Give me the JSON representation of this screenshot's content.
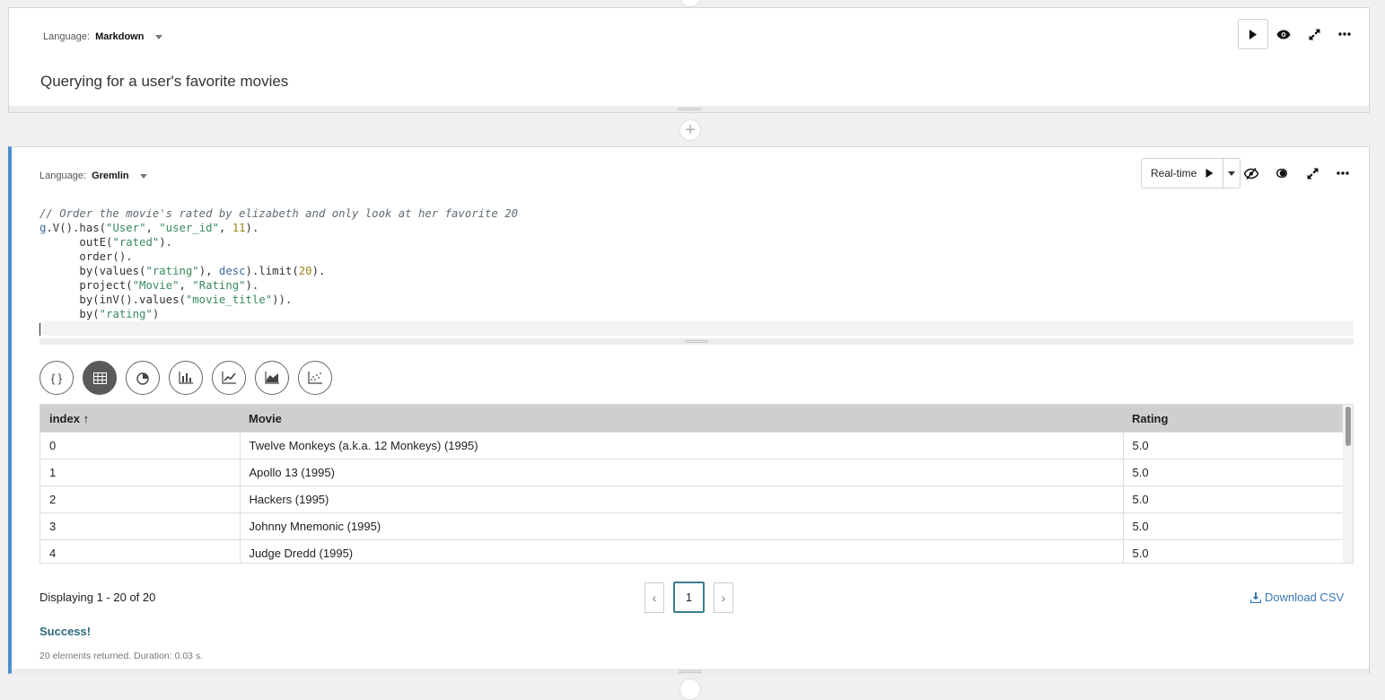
{
  "markdown_cell": {
    "language_label": "Language:",
    "language_value": "Markdown",
    "content": "Querying for a user's favorite movies"
  },
  "gremlin_cell": {
    "language_label": "Language:",
    "language_value": "Gremlin",
    "run_mode": "Real-time"
  },
  "results": {
    "columns": [
      "index",
      "Movie",
      "Rating"
    ],
    "sort_indicator": "↑",
    "rows": [
      [
        "0",
        "Twelve Monkeys (a.k.a. 12 Monkeys) (1995)",
        "5.0"
      ],
      [
        "1",
        "Apollo 13 (1995)",
        "5.0"
      ],
      [
        "2",
        "Hackers (1995)",
        "5.0"
      ],
      [
        "3",
        "Johnny Mnemonic (1995)",
        "5.0"
      ],
      [
        "4",
        "Judge Dredd (1995)",
        "5.0"
      ]
    ],
    "displaying": "Displaying 1 - 20 of 20",
    "current_page": "1",
    "download_label": "Download CSV",
    "status": "Success!",
    "meta": "20 elements returned. Duration: 0.03 s."
  }
}
